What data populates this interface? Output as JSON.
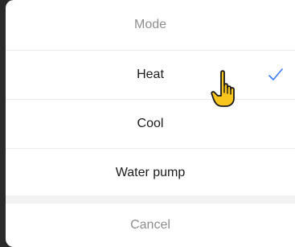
{
  "sheet": {
    "title": "Mode",
    "options": [
      {
        "label": "Heat",
        "selected": true
      },
      {
        "label": "Cool",
        "selected": false
      },
      {
        "label": "Water pump",
        "selected": false
      }
    ],
    "cancel_label": "Cancel"
  },
  "colors": {
    "accent": "#3d7cf5",
    "muted_text": "#8e8e8e",
    "text": "#1a1a1a",
    "hand_fill": "#f8c51c",
    "hand_stroke": "#1a1a1a"
  },
  "icons": {
    "check": "checkmark-icon",
    "pointer": "pointing-hand-icon"
  }
}
